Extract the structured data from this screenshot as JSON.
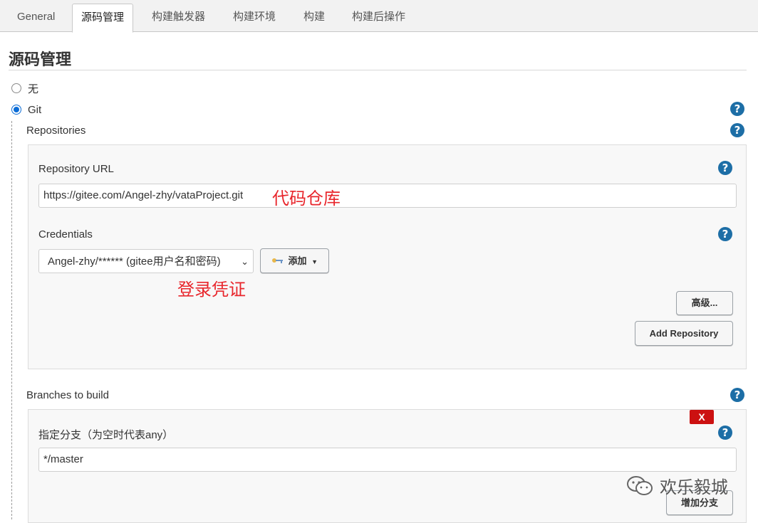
{
  "tabs": [
    {
      "label": "General",
      "active": false
    },
    {
      "label": "源码管理",
      "active": true
    },
    {
      "label": "构建触发器",
      "active": false
    },
    {
      "label": "构建环境",
      "active": false
    },
    {
      "label": "构建",
      "active": false
    },
    {
      "label": "构建后操作",
      "active": false
    }
  ],
  "scm": {
    "title": "源码管理",
    "options": [
      {
        "label": "无",
        "selected": false
      },
      {
        "label": "Git",
        "selected": true
      }
    ],
    "help_symbol": "?"
  },
  "repositories": {
    "label": "Repositories",
    "url_label": "Repository URL",
    "url_value": "https://gitee.com/Angel-zhy/vataProject.git",
    "credentials_label": "Credentials",
    "credentials_selected": "Angel-zhy/****** (gitee用户名和密码)",
    "add_button": "添加",
    "advanced_button": "高级...",
    "add_repository_button": "Add Repository"
  },
  "annotations": {
    "repo": "代码仓库",
    "credentials": "登录凭证"
  },
  "branches": {
    "label": "Branches to build",
    "delete_button": "X",
    "specifier_label": "指定分支（为空时代表any）",
    "specifier_value": "*/master",
    "add_branch_button": "增加分支"
  },
  "watermark": {
    "text": "欢乐毅城",
    "icon": "wechat-icon"
  },
  "colors": {
    "accent": "#1d6ea6",
    "annotation_red": "#e8262c",
    "delete_red": "#cc1111"
  }
}
